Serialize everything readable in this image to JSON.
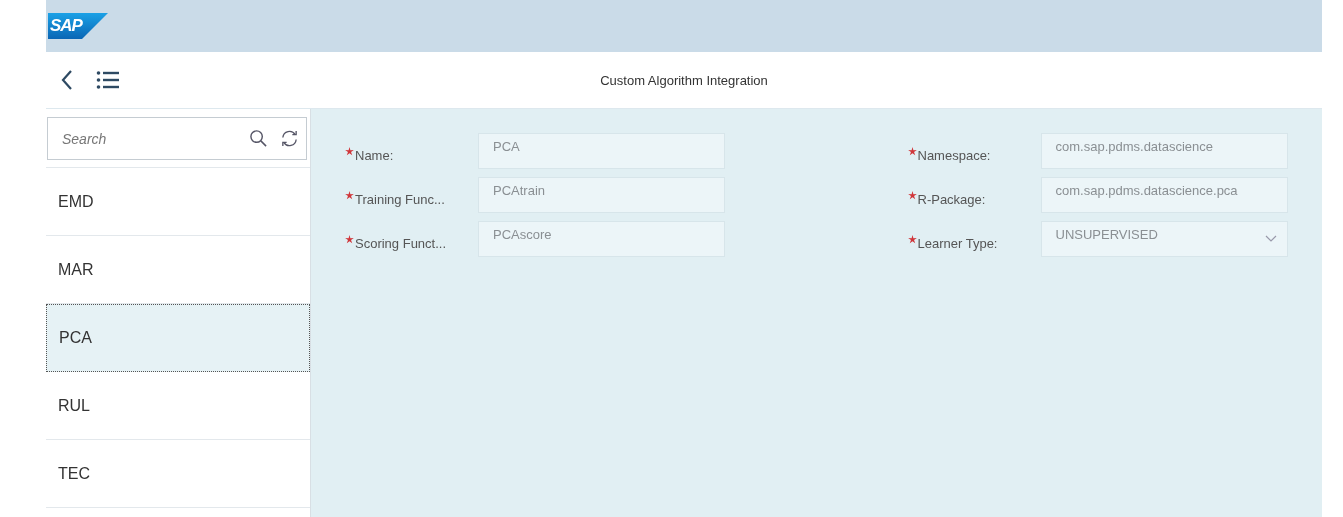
{
  "logo": "SAP",
  "header": {
    "title": "Custom Algorithm Integration"
  },
  "search": {
    "placeholder": "Search"
  },
  "list_items": [
    {
      "label": "EMD",
      "selected": false
    },
    {
      "label": "MAR",
      "selected": false
    },
    {
      "label": "PCA",
      "selected": true
    },
    {
      "label": "RUL",
      "selected": false
    },
    {
      "label": "TEC",
      "selected": false
    }
  ],
  "form": {
    "left": [
      {
        "label": "Name:",
        "required": true,
        "value": "PCA",
        "kind": "input"
      },
      {
        "label": "Training Func...",
        "required": true,
        "value": "PCAtrain",
        "kind": "input"
      },
      {
        "label": "Scoring Funct...",
        "required": true,
        "value": "PCAscore",
        "kind": "input"
      }
    ],
    "right": [
      {
        "label": "Namespace:",
        "required": true,
        "value": "com.sap.pdms.datascience",
        "kind": "input"
      },
      {
        "label": "R-Package:",
        "required": true,
        "value": "com.sap.pdms.datascience.pca",
        "kind": "input"
      },
      {
        "label": "Learner Type:",
        "required": true,
        "value": "UNSUPERVISED",
        "kind": "select"
      }
    ]
  }
}
